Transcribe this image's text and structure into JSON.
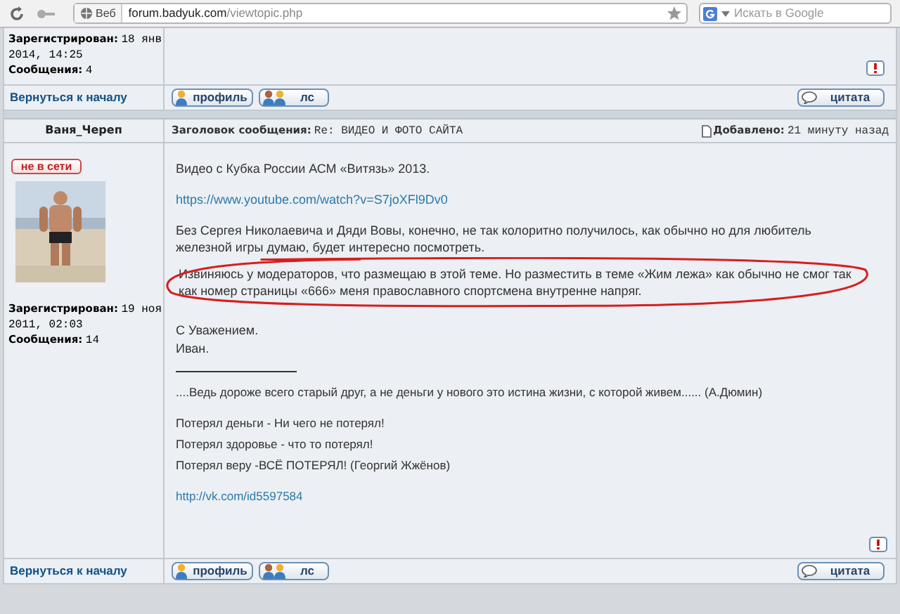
{
  "browser": {
    "search_engine_label": "Веб",
    "url_host": "forum.badyuk.com",
    "url_path": "/viewtopic.php",
    "search_placeholder": "Искать в Google"
  },
  "previous_post": {
    "registered_label": "Зарегистрирован:",
    "registered": "18 янв 2014, 14:25",
    "posts_label": "Сообщения:",
    "posts": "4"
  },
  "previous_footer": {
    "back_link": "Вернуться к началу",
    "buttons": [
      {
        "kind": "profile",
        "label": "профиль"
      },
      {
        "kind": "pm",
        "label": "лс"
      }
    ],
    "quote_button": "цитата"
  },
  "post": {
    "author": "Ваня_Череп",
    "online": false,
    "status": "не в сети",
    "subject_label": "Заголовок сообщения:",
    "subject": "Re: ВИДЕО И ФОТО САЙТА",
    "posted_label": "Добавлено:",
    "posted": "21 минуту назад",
    "registered_label": "Зарегистрирован:",
    "registered": "19 ноя 2011, 02:03",
    "posts_label": "Сообщения:",
    "posts": "14",
    "blocks": [
      {
        "kind": "text",
        "lines": [
          {
            "text": "Видео с Кубка России АСМ «Витязь» 2013.",
            "circled": false
          }
        ]
      },
      {
        "kind": "link",
        "lines": [
          {
            "text": "https://www.youtube.com/watch?v=S7joXFl9Dv0",
            "circled": false
          }
        ]
      },
      {
        "kind": "text",
        "lines": [
          {
            "text": "Без Сергея Николаевича и Дяди Вовы, конечно, не так колоритно получилось, как обычно но для любитель железной игры думаю, будет интересно посмотреть.",
            "circled": false
          },
          {
            "text": "Извиняюсь у модераторов, что размещаю в этой теме. Но разместить в теме «Жим лежа» как обычно не смог так как номер страницы «666» меня православного спортсмена внутренне напряг.",
            "circled": true
          }
        ]
      },
      {
        "kind": "text",
        "lines": [
          {
            "text": "С Уважением.",
            "circled": false
          },
          {
            "text": "Иван.",
            "circled": false
          }
        ]
      }
    ],
    "signature": [
      {
        "kind": "text",
        "lines": [
          {
            "text": "....Ведь дороже всего старый друг, а не деньги у нового это истина жизни, с которой живем...... (А.Дюмин)",
            "circled": false
          }
        ]
      },
      {
        "kind": "text",
        "lines": [
          {
            "text": "Потерял деньги - Ни чего не потерял!",
            "circled": false
          },
          {
            "text": "Потерял здоровье - что то потерял!",
            "circled": false
          },
          {
            "text": "Потерял веру -ВСЁ ПОТЕРЯЛ!  (Георгий Жжёнов)",
            "circled": false
          }
        ]
      },
      {
        "kind": "link",
        "lines": [
          {
            "text": "http://vk.com/id5597584",
            "circled": false
          }
        ]
      }
    ]
  },
  "post_footer": {
    "back_link": "Вернуться к началу",
    "buttons": [
      {
        "kind": "profile",
        "label": "профиль"
      },
      {
        "kind": "pm",
        "label": "лс"
      }
    ],
    "quote_button": "цитата"
  }
}
